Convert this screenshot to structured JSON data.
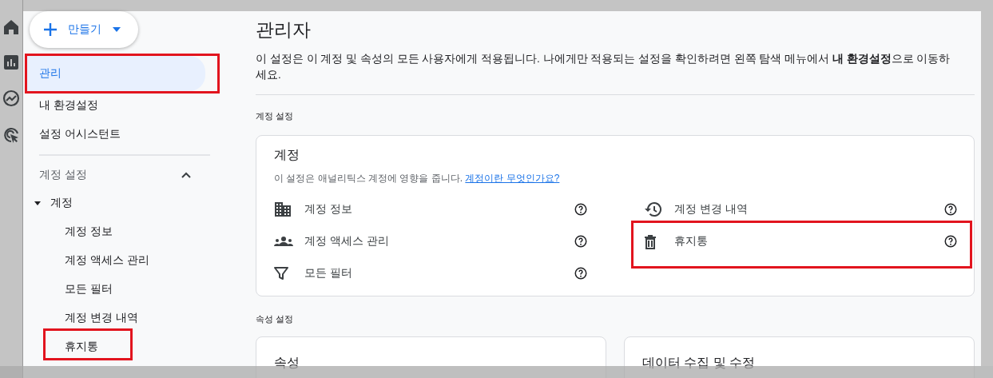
{
  "create_button": {
    "label": "만들기"
  },
  "sidebar": {
    "items": [
      {
        "label": "관리",
        "selected": true,
        "highlighted": true
      },
      {
        "label": "내 환경설정",
        "selected": false,
        "highlighted": false
      },
      {
        "label": "설정 어시스턴트",
        "selected": false,
        "highlighted": false
      }
    ],
    "sections": [
      {
        "title": "계정 설정",
        "expanded": true,
        "groups": [
          {
            "label": "계정",
            "expanded": true,
            "children": [
              {
                "label": "계정 정보",
                "highlighted": false
              },
              {
                "label": "계정 액세스 관리",
                "highlighted": false
              },
              {
                "label": "모든 필터",
                "highlighted": false
              },
              {
                "label": "계정 변경 내역",
                "highlighted": false
              },
              {
                "label": "휴지통",
                "highlighted": true
              }
            ]
          }
        ]
      }
    ]
  },
  "main": {
    "title": "관리자",
    "description": "이 설정은 이 계정 및 속성의 모든 사용자에게 적용됩니다. 나에게만 적용되는 설정을 확인하려면 왼쪽 탐색 메뉴에서 **내 환경설정**으로 이동하세요.",
    "sections": [
      {
        "heading": "계정 설정",
        "cards": [
          {
            "title": "계정",
            "subtitle": "이 설정은 애널리틱스 계정에 영향을 줍니다.",
            "link": "계정이란 무엇인가요?",
            "columns": [
              [
                {
                  "label": "계정 정보",
                  "kind": "building",
                  "highlighted": false
                },
                {
                  "label": "계정 액세스 관리",
                  "kind": "people",
                  "highlighted": false
                },
                {
                  "label": "모든 필터",
                  "kind": "filter",
                  "highlighted": false
                }
              ],
              [
                {
                  "label": "계정 변경 내역",
                  "kind": "history",
                  "highlighted": false
                },
                {
                  "label": "휴지통",
                  "kind": "trash",
                  "highlighted": true
                }
              ]
            ]
          }
        ]
      },
      {
        "heading": "속성 설정",
        "cards": [
          {
            "title": "속성"
          },
          {
            "title": "데이터 수집 및 수정"
          }
        ]
      }
    ]
  }
}
